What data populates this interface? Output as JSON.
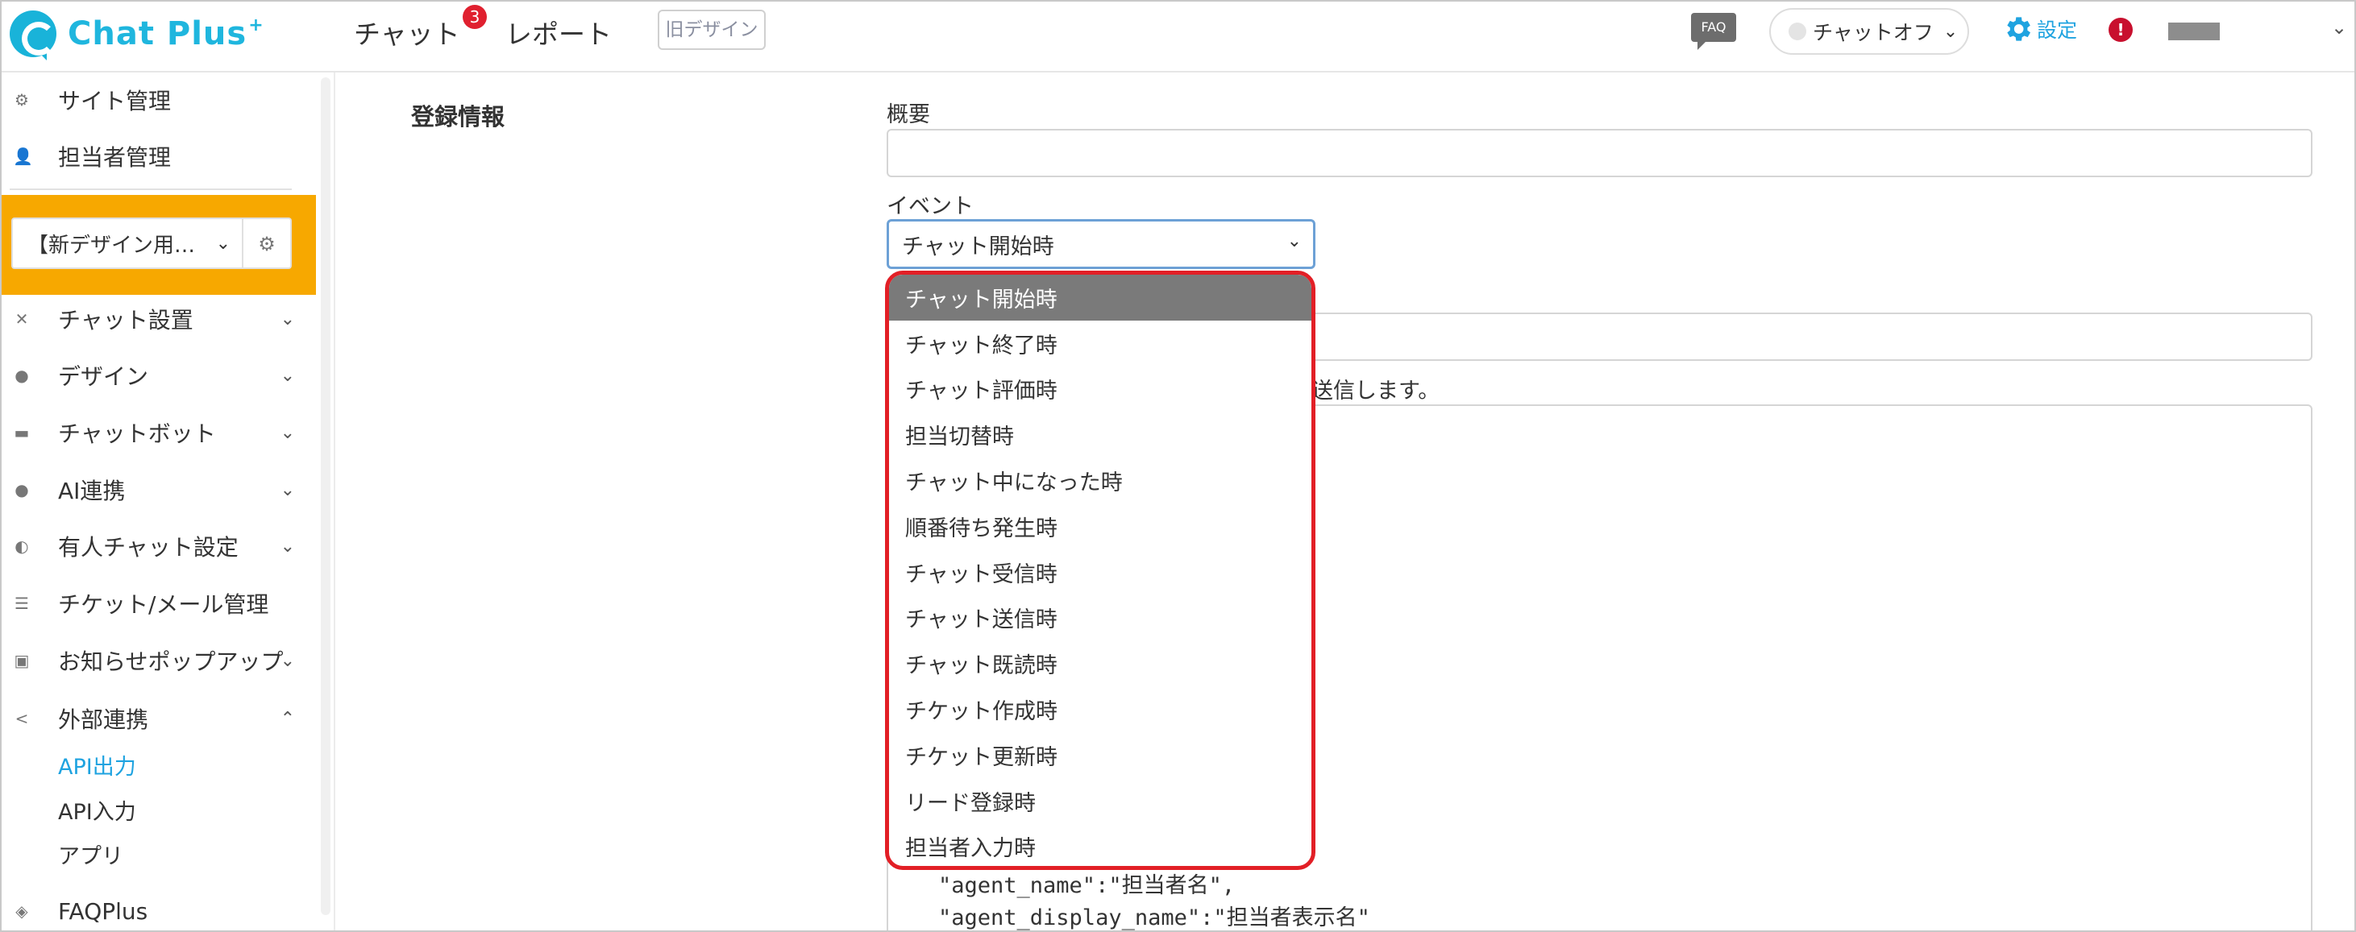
{
  "header": {
    "logo_text": "Chat Plus",
    "logo_sup": "+",
    "nav": [
      "チャット",
      "レポート"
    ],
    "chat_badge": "3",
    "old_design_label": "旧デザイン",
    "faq_label": "FAQ",
    "status_label": "チャットオフ",
    "settings_label": "設定",
    "alert_label": "!"
  },
  "sidebar": {
    "top_items": [
      "サイト管理",
      "担当者管理"
    ],
    "site_select_value": "【新デザイン用…",
    "menu_items": [
      "チャット設置",
      "デザイン",
      "チャットボット",
      "AI連携",
      "有人チャット設定",
      "チケット/メール管理",
      "お知らせポップアップ",
      "外部連携"
    ],
    "sub_items": [
      "API出力",
      "API入力",
      "アプリ"
    ],
    "bottom_item": "FAQPlus"
  },
  "main": {
    "section_label": "登録情報",
    "summary_label": "概要",
    "summary_value": "",
    "event_label": "イベント",
    "event_selected": "チャット開始時",
    "partial_text": "送信します。",
    "code_lines": [
      "\"agent_name\":\"担当者名\",",
      "\"agent_display_name\":\"担当者表示名\""
    ]
  },
  "dropdown": {
    "options": [
      "チャット開始時",
      "チャット終了時",
      "チャット評価時",
      "担当切替時",
      "チャット中になった時",
      "順番待ち発生時",
      "チャット受信時",
      "チャット送信時",
      "チャット既読時",
      "チケット作成時",
      "チケット更新時",
      "リード登録時",
      "担当者入力時"
    ],
    "selected_index": 0
  },
  "colors": {
    "brand": "#1fb6de",
    "accent_orange": "#f7a800",
    "highlight_red": "#e21f26",
    "active_blue": "#1fa3e0"
  }
}
